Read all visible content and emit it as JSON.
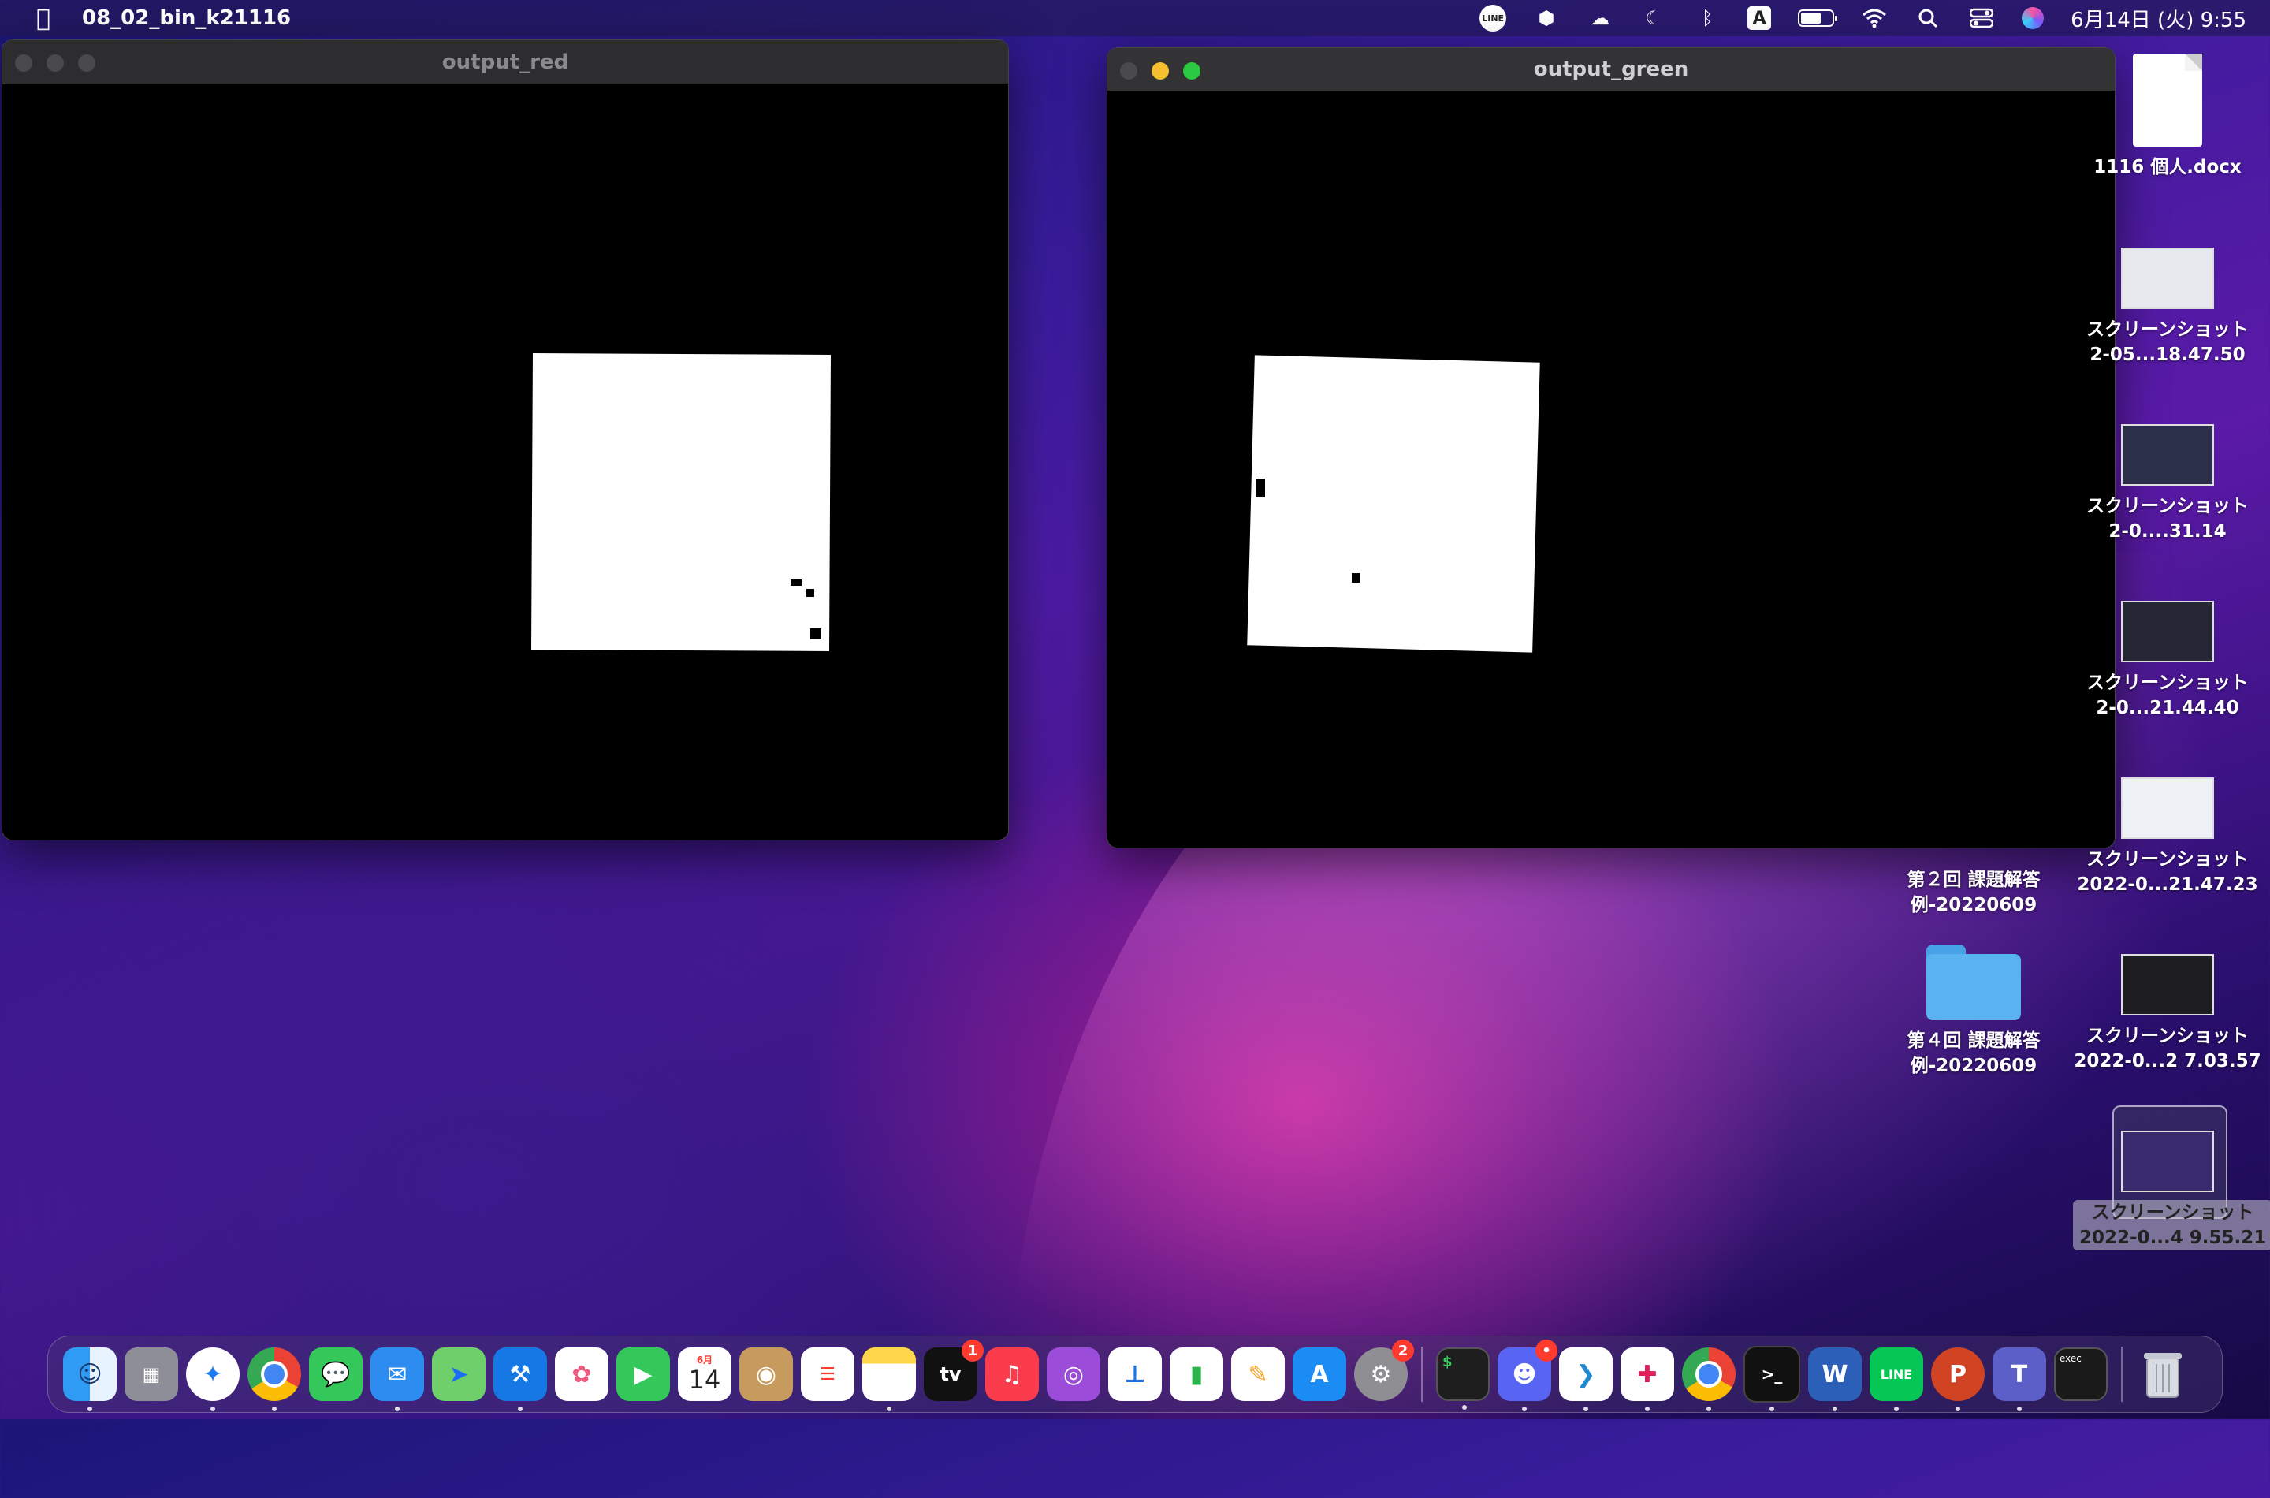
{
  "menubar": {
    "app_name": "08_02_bin_k21116",
    "input_method": "A",
    "clock": "6月14日 (火)  9:55",
    "line_label": "LINE"
  },
  "windows": {
    "red": {
      "title": "output_red"
    },
    "green": {
      "title": "output_green"
    }
  },
  "desktop": {
    "icons": [
      {
        "label": "1116 個人.docx",
        "type": "doc"
      },
      {
        "label": "スクリーンショット\n2-05...18.47.50",
        "type": "screenshot"
      },
      {
        "label": "スクリーンショット\n2-0....31.14",
        "type": "screenshot"
      },
      {
        "label": "スクリーンショット\n2-0...21.44.40",
        "type": "screenshot"
      },
      {
        "label": "スクリーンショット\n2022-0...21.47.23",
        "type": "screenshot"
      },
      {
        "label": "スクリーンショット\n2022-0...2 7.03.57",
        "type": "screenshot"
      },
      {
        "label": "スクリーンショット\n2022-0...4 9.55.21",
        "type": "screenshot",
        "selected": true
      },
      {
        "label": "第２回 課題解答\n例-20220609",
        "type": "folder"
      },
      {
        "label": "第４回 課題解答\n例-20220609",
        "type": "folder"
      }
    ]
  },
  "dock": {
    "calendar_month": "6月",
    "calendar_day": "14",
    "tv_label": "tv",
    "tv_badge": "1",
    "settings_badge": "2",
    "discord_badge": "•",
    "terminal_label": "$",
    "word_label": "W",
    "line_label": "LINE",
    "ppt_label": "P",
    "teams_label": "T",
    "exec_label": "exec",
    "iterm_label": ">_"
  }
}
